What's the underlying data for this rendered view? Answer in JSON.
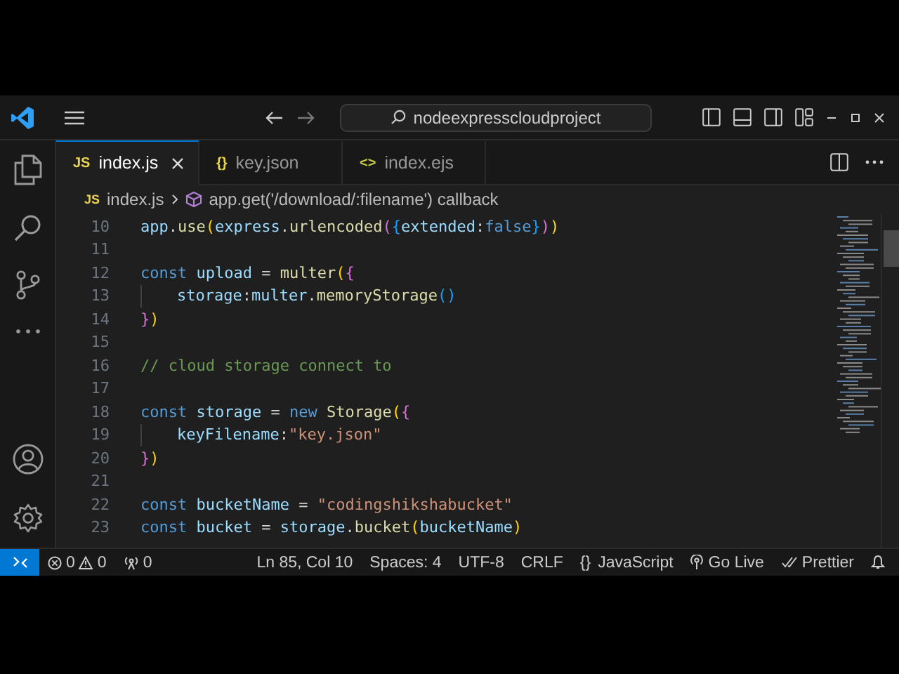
{
  "title_bar": {
    "search": "nodeexpresscloudproject"
  },
  "tabs": [
    {
      "icon": "JS",
      "kind": "js",
      "label": "index.js",
      "selected": true
    },
    {
      "icon": "{}",
      "kind": "json",
      "label": "key.json",
      "selected": false
    },
    {
      "icon": "<>",
      "kind": "ejs",
      "label": "index.ejs",
      "selected": false
    }
  ],
  "breadcrumb": {
    "icon": "JS",
    "file": "index.js",
    "symbol": "app.get('/download/:filename') callback"
  },
  "code_lines": [
    {
      "number": "10",
      "indented": false,
      "tokens": [
        {
          "kind": "var",
          "text": "app"
        },
        {
          "kind": "plain",
          "text": "."
        },
        {
          "kind": "func",
          "text": "use"
        },
        {
          "kind": "b1",
          "text": "("
        },
        {
          "kind": "var",
          "text": "express"
        },
        {
          "kind": "plain",
          "text": "."
        },
        {
          "kind": "func",
          "text": "urlencoded"
        },
        {
          "kind": "b2",
          "text": "("
        },
        {
          "kind": "b3",
          "text": "{"
        },
        {
          "kind": "var",
          "text": "extended"
        },
        {
          "kind": "plain",
          "text": ":"
        },
        {
          "kind": "keyword",
          "text": "false"
        },
        {
          "kind": "b3",
          "text": "}"
        },
        {
          "kind": "b2",
          "text": ")"
        },
        {
          "kind": "b1",
          "text": ")"
        }
      ]
    },
    {
      "number": "11",
      "indented": false
    },
    {
      "number": "12",
      "indented": false,
      "tokens": [
        {
          "kind": "keyword",
          "text": "const"
        },
        {
          "kind": "var",
          "text": " upload"
        },
        {
          "kind": "plain",
          "text": " = "
        },
        {
          "kind": "func",
          "text": "multer"
        },
        {
          "kind": "b1",
          "text": "("
        },
        {
          "kind": "b2",
          "text": "{"
        }
      ]
    },
    {
      "number": "13",
      "indented": true,
      "tokens": [
        {
          "kind": "var",
          "text": "storage"
        },
        {
          "kind": "plain",
          "text": ":"
        },
        {
          "kind": "var",
          "text": "multer"
        },
        {
          "kind": "plain",
          "text": "."
        },
        {
          "kind": "func",
          "text": "memoryStorage"
        },
        {
          "kind": "b3",
          "text": "()"
        }
      ]
    },
    {
      "number": "14",
      "indented": false,
      "tokens": [
        {
          "kind": "b2",
          "text": "}"
        },
        {
          "kind": "b1",
          "text": ")"
        }
      ]
    },
    {
      "number": "15",
      "indented": false
    },
    {
      "number": "16",
      "indented": false,
      "tokens": [
        {
          "kind": "comment",
          "text": "// cloud storage connect to"
        }
      ]
    },
    {
      "number": "17",
      "indented": false
    },
    {
      "number": "18",
      "indented": false,
      "tokens": [
        {
          "kind": "keyword",
          "text": "const"
        },
        {
          "kind": "var",
          "text": " storage"
        },
        {
          "kind": "plain",
          "text": " = "
        },
        {
          "kind": "keyword",
          "text": "new"
        },
        {
          "kind": "func",
          "text": " Storage"
        },
        {
          "kind": "b1",
          "text": "("
        },
        {
          "kind": "b2",
          "text": "{"
        }
      ]
    },
    {
      "number": "19",
      "indented": true,
      "tokens": [
        {
          "kind": "var",
          "text": "keyFilename"
        },
        {
          "kind": "plain",
          "text": ":"
        },
        {
          "kind": "string",
          "text": "\"key.json\""
        }
      ]
    },
    {
      "number": "20",
      "indented": false,
      "tokens": [
        {
          "kind": "b2",
          "text": "}"
        },
        {
          "kind": "b1",
          "text": ")"
        }
      ]
    },
    {
      "number": "21",
      "indented": false
    },
    {
      "number": "22",
      "indented": false,
      "tokens": [
        {
          "kind": "keyword",
          "text": "const"
        },
        {
          "kind": "var",
          "text": " bucketName"
        },
        {
          "kind": "plain",
          "text": " = "
        },
        {
          "kind": "string",
          "text": "\"codingshikshabucket\""
        }
      ]
    },
    {
      "number": "23",
      "indented": false,
      "tokens": [
        {
          "kind": "keyword",
          "text": "const"
        },
        {
          "kind": "var",
          "text": " bucket"
        },
        {
          "kind": "plain",
          "text": " = "
        },
        {
          "kind": "var",
          "text": "storage"
        },
        {
          "kind": "plain",
          "text": "."
        },
        {
          "kind": "func",
          "text": "bucket"
        },
        {
          "kind": "b1",
          "text": "("
        },
        {
          "kind": "var",
          "text": "bucketName"
        },
        {
          "kind": "b1",
          "text": ")"
        }
      ]
    }
  ],
  "status_bar": {
    "errors": "0",
    "warnings": "0",
    "ports": "0",
    "items": [
      "Ln 85, Col 10",
      "Spaces: 4",
      "UTF-8",
      "CRLF"
    ],
    "language_icon": "{}",
    "language": "JavaScript",
    "go_live": "Go Live",
    "prettier": "Prettier"
  }
}
